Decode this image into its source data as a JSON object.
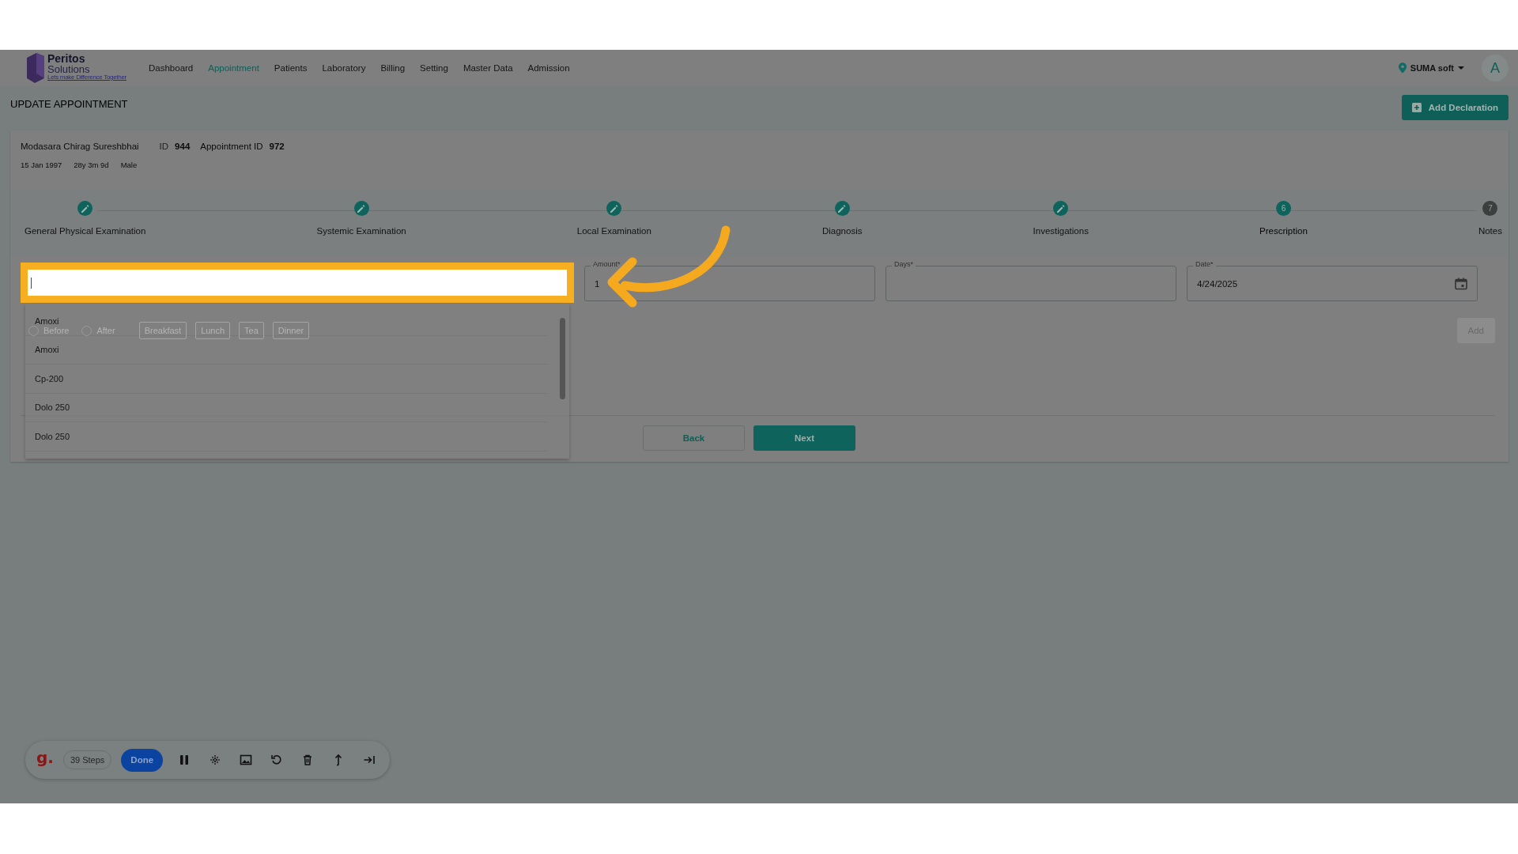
{
  "nav": {
    "logo": {
      "name": "Peritos",
      "sub": "Solutions",
      "tagline": "Lets make Difference Together"
    },
    "items": [
      {
        "label": "Dashboard",
        "selected": false
      },
      {
        "label": "Appointment",
        "selected": true
      },
      {
        "label": "Patients",
        "selected": false
      },
      {
        "label": "Laboratory",
        "selected": false
      },
      {
        "label": "Billing",
        "selected": false
      },
      {
        "label": "Setting",
        "selected": false
      },
      {
        "label": "Master Data",
        "selected": false
      },
      {
        "label": "Admission",
        "selected": false
      }
    ],
    "location": "SUMA soft",
    "avatar": "A"
  },
  "page": {
    "title": "UPDATE APPOINTMENT",
    "action": "Add Declaration"
  },
  "patient": {
    "name": "Modasara Chirag Sureshbhai",
    "id_label": "ID",
    "id": "944",
    "appointment_label": "Appointment ID",
    "appointment_id": "972",
    "dob": "15 Jan 1997",
    "age": "28y 3m 9d",
    "gender": "Male"
  },
  "steps": [
    {
      "label": "General Physical Examination",
      "completed": true,
      "selected": false
    },
    {
      "label": "Systemic Examination",
      "completed": true,
      "selected": false
    },
    {
      "label": "Local Examination",
      "completed": true,
      "selected": false
    },
    {
      "label": "Diagnosis",
      "completed": true,
      "selected": false
    },
    {
      "label": "Investigations",
      "completed": true,
      "selected": false
    },
    {
      "label": "Prescription",
      "completed": false,
      "selected": true,
      "number": "6"
    },
    {
      "label": "Notes",
      "completed": false,
      "selected": false,
      "number": "7"
    }
  ],
  "form": {
    "fields": [
      {
        "kind": "search",
        "highlighted": true
      },
      {
        "kind": "text",
        "label": "Amount*",
        "value": "1",
        "highlighted": false
      },
      {
        "kind": "text",
        "label": "Days*",
        "highlighted": false
      },
      {
        "kind": "date",
        "label": "Date*",
        "value": "4/24/2025",
        "highlighted": false
      }
    ],
    "timing": [
      {
        "label": "Before",
        "selected": false
      },
      {
        "label": "After",
        "selected": false
      }
    ],
    "meals": [
      {
        "label": "Breakfast",
        "selected": false
      },
      {
        "label": "Lunch",
        "selected": false
      },
      {
        "label": "Tea",
        "selected": false
      },
      {
        "label": "Dinner",
        "selected": false
      }
    ],
    "add": {
      "label": "Add",
      "disabled": true
    }
  },
  "dropdown": {
    "options": [
      {
        "label": "Amoxi",
        "selected": false
      },
      {
        "label": "Amoxi",
        "selected": false
      },
      {
        "label": "Cp-200",
        "selected": false
      },
      {
        "label": "Dolo 250",
        "selected": false
      },
      {
        "label": "Dolo 250",
        "selected": false
      }
    ]
  },
  "buttons": {
    "back": "Back",
    "next": "Next"
  },
  "recorder": {
    "logo": "g.",
    "steps": "39 Steps",
    "done": "Done"
  }
}
